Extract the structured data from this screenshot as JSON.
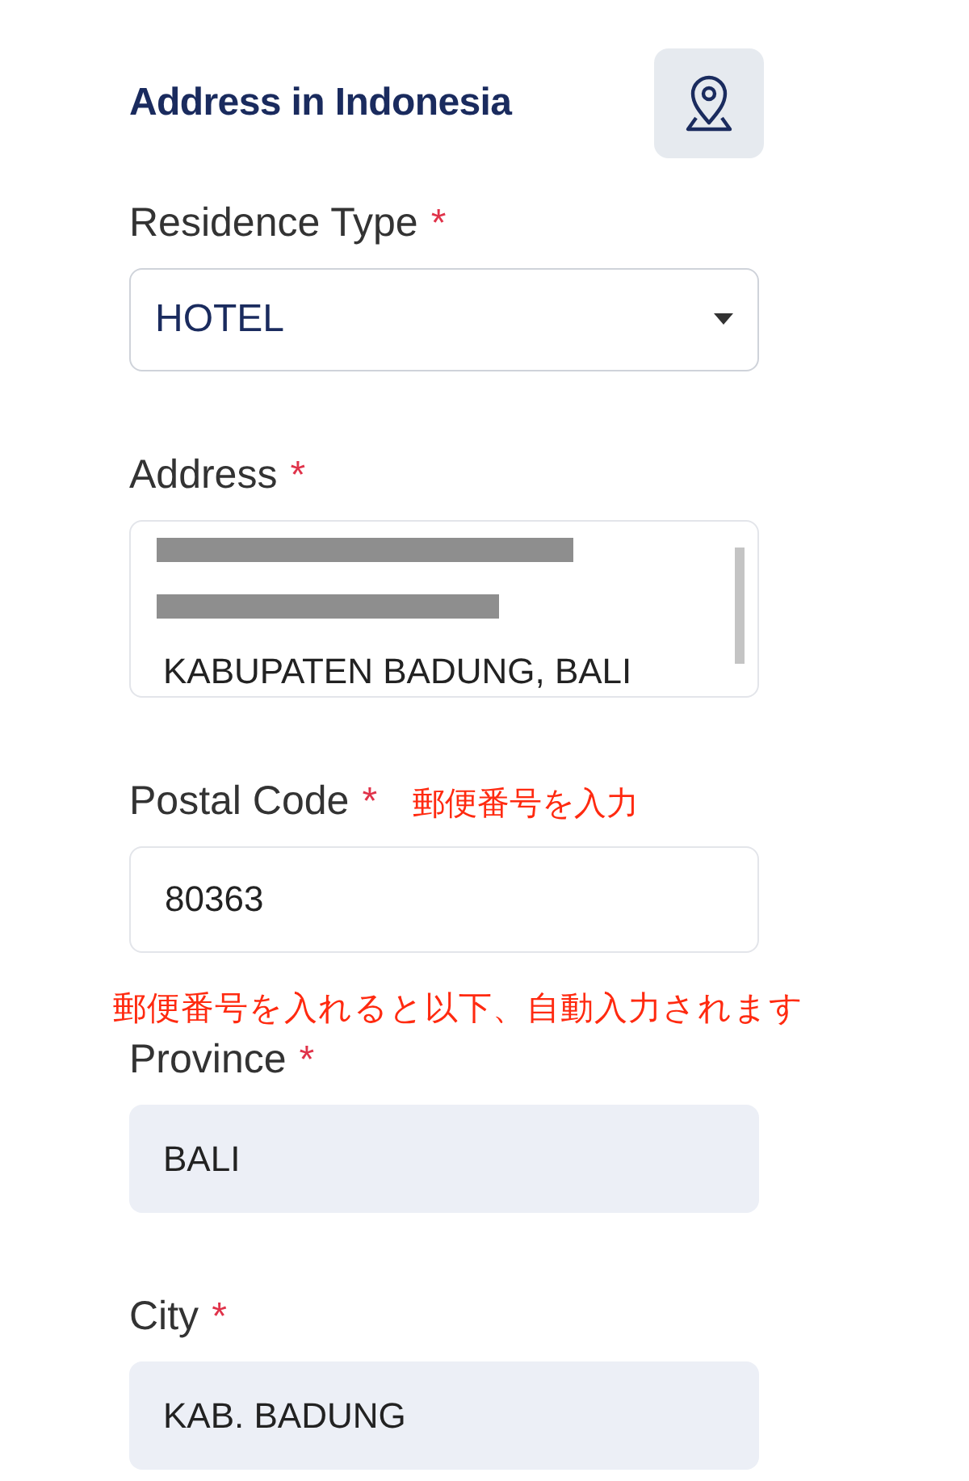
{
  "section": {
    "title": "Address in Indonesia"
  },
  "fields": [
    {
      "kind": "select",
      "label": "Residence Type",
      "required_mark": "*",
      "value": "HOTEL"
    },
    {
      "kind": "textarea",
      "label": "Address",
      "required_mark": "*",
      "lines": [
        {
          "kind": "redacted"
        },
        {
          "kind": "redacted"
        },
        {
          "kind": "text",
          "text": "KABUPATEN BADUNG, BALI"
        }
      ]
    },
    {
      "kind": "input",
      "label": "Postal Code",
      "required_mark": "*",
      "value": "80363",
      "note": "郵便番号を入力",
      "note_below": "郵便番号を入れると以下、自動入力されます"
    },
    {
      "kind": "readonly",
      "label": "Province",
      "required_mark": "*",
      "value": "BALI"
    },
    {
      "kind": "readonly",
      "label": "City",
      "required_mark": "*",
      "value": "KAB. BADUNG"
    }
  ]
}
